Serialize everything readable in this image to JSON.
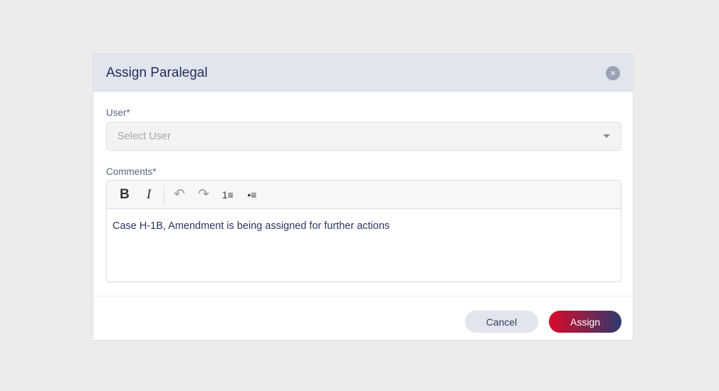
{
  "dialog": {
    "title": "Assign Paralegal",
    "close_icon": "×"
  },
  "user": {
    "label": "User*",
    "placeholder": "Select User"
  },
  "comments": {
    "label": "Comments*",
    "text": "Case H-1B, Amendment is being assigned for further actions",
    "toolbar": {
      "bold": "B",
      "italic": "I",
      "undo": "↶",
      "redo": "↷",
      "ordered_list": "1≡",
      "bullet_list": "•≡"
    }
  },
  "buttons": {
    "cancel": "Cancel",
    "assign": "Assign"
  }
}
